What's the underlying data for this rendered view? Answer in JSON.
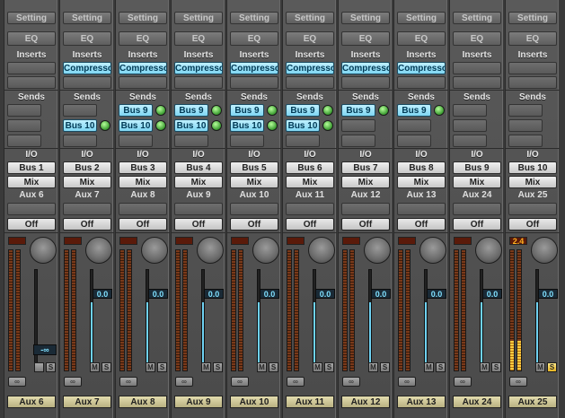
{
  "labels": {
    "setting": "Setting",
    "eq": "EQ",
    "inserts": "Inserts",
    "sends": "Sends",
    "io": "I/O",
    "off": "Off",
    "mute": "M",
    "solo": "S",
    "link": "∞"
  },
  "colors": {
    "insert_blue": "#7fd6f2",
    "send_knob_green": "#3a9a30",
    "peak_amber": "#ffb020",
    "name_bar": "#d6cf9f",
    "solo_yellow": "#e7b420"
  },
  "strips": [
    {
      "name": "Aux 6",
      "insert": "",
      "sends": [
        "",
        ""
      ],
      "output": "Bus 1",
      "mode": "Mix",
      "aux_label": "Aux 6",
      "vol": "-∞",
      "peak": "",
      "level": 0,
      "fader": 0,
      "solo_lit": false,
      "show_mute": false
    },
    {
      "name": "Aux 7",
      "insert": "Compresso",
      "sends": [
        "",
        "Bus 10"
      ],
      "output": "Bus 2",
      "mode": "Mix",
      "aux_label": "Aux 7",
      "vol": "0.0",
      "peak": "",
      "level": 0,
      "fader": 0.68,
      "solo_lit": false,
      "show_mute": true
    },
    {
      "name": "Aux 8",
      "insert": "Compresso",
      "sends": [
        "Bus 9",
        "Bus 10"
      ],
      "output": "Bus 3",
      "mode": "Mix",
      "aux_label": "Aux 8",
      "vol": "0.0",
      "peak": "",
      "level": 0,
      "fader": 0.68,
      "solo_lit": false,
      "show_mute": true
    },
    {
      "name": "Aux 9",
      "insert": "Compresso",
      "sends": [
        "Bus 9",
        "Bus 10"
      ],
      "output": "Bus 4",
      "mode": "Mix",
      "aux_label": "Aux 9",
      "vol": "0.0",
      "peak": "",
      "level": 0,
      "fader": 0.68,
      "solo_lit": false,
      "show_mute": true
    },
    {
      "name": "Aux 10",
      "insert": "Compresso",
      "sends": [
        "Bus 9",
        "Bus 10"
      ],
      "output": "Bus 5",
      "mode": "Mix",
      "aux_label": "Aux 10",
      "vol": "0.0",
      "peak": "",
      "level": 0,
      "fader": 0.68,
      "solo_lit": false,
      "show_mute": true
    },
    {
      "name": "Aux 11",
      "insert": "Compresso",
      "sends": [
        "Bus 9",
        "Bus 10"
      ],
      "output": "Bus 6",
      "mode": "Mix",
      "aux_label": "Aux 11",
      "vol": "0.0",
      "peak": "",
      "level": 0,
      "fader": 0.68,
      "solo_lit": false,
      "show_mute": true
    },
    {
      "name": "Aux 12",
      "insert": "Compresso",
      "sends": [
        "Bus 9",
        ""
      ],
      "output": "Bus 7",
      "mode": "Mix",
      "aux_label": "Aux 12",
      "vol": "0.0",
      "peak": "",
      "level": 0,
      "fader": 0.68,
      "solo_lit": false,
      "show_mute": true
    },
    {
      "name": "Aux 13",
      "insert": "Compresso",
      "sends": [
        "Bus 9",
        ""
      ],
      "output": "Bus 8",
      "mode": "Mix",
      "aux_label": "Aux 13",
      "vol": "0.0",
      "peak": "",
      "level": 0,
      "fader": 0.68,
      "solo_lit": false,
      "show_mute": true
    },
    {
      "name": "Aux 24",
      "insert": "",
      "sends": [
        "",
        ""
      ],
      "output": "Bus 9",
      "mode": "Mix",
      "aux_label": "Aux 24",
      "vol": "0.0",
      "peak": "",
      "level": 0,
      "fader": 0.68,
      "solo_lit": false,
      "show_mute": true
    },
    {
      "name": "Aux 25",
      "insert": "",
      "sends": [
        "",
        ""
      ],
      "output": "Bus 10",
      "mode": "Mix",
      "aux_label": "Aux 25",
      "vol": "0.0",
      "peak": "2.4",
      "level": 0.55,
      "fader": 0.68,
      "solo_lit": true,
      "show_mute": true
    }
  ]
}
